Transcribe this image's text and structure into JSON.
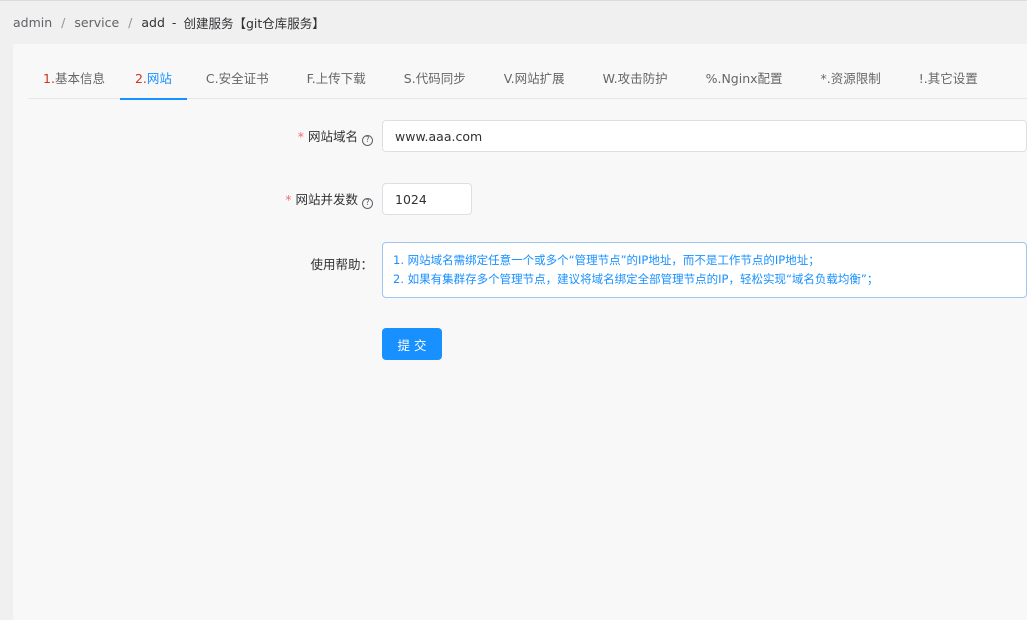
{
  "breadcrumb": {
    "items": [
      "admin",
      "service",
      "add"
    ],
    "separator": "/",
    "suffix_dash": "-",
    "page_title": "创建服务【git仓库服务】"
  },
  "tabs": [
    {
      "num": "1.",
      "label": "基本信息"
    },
    {
      "num": "2.",
      "label": "网站"
    },
    {
      "num": "C.",
      "label": "安全证书"
    },
    {
      "num": "F.",
      "label": "上传下载"
    },
    {
      "num": "S.",
      "label": "代码同步"
    },
    {
      "num": "V.",
      "label": "网站扩展"
    },
    {
      "num": "W.",
      "label": "攻击防护"
    },
    {
      "num": "%.",
      "label": "Nginx配置"
    },
    {
      "num": "*.",
      "label": "资源限制"
    },
    {
      "num": "!.",
      "label": "其它设置"
    }
  ],
  "form": {
    "required_mark": "*",
    "domain_label": "网站域名",
    "domain_value": "www.aaa.com",
    "concurrency_label": "网站并发数",
    "concurrency_value": "1024",
    "help_label": "使用帮助：",
    "help_lines": [
      "1. 网站域名需绑定任意一个或多个“管理节点”的IP地址，而不是工作节点的IP地址；",
      "2. 如果有集群存多个管理节点，建议将域名绑定全部管理节点的IP，轻松实现“域名负载均衡”；"
    ],
    "help_icon_glyph": "?",
    "submit_label": "提交"
  },
  "colors": {
    "accent": "#1890ff",
    "tab_number_red": "#d0341a",
    "required_star": "#f56c6c"
  }
}
